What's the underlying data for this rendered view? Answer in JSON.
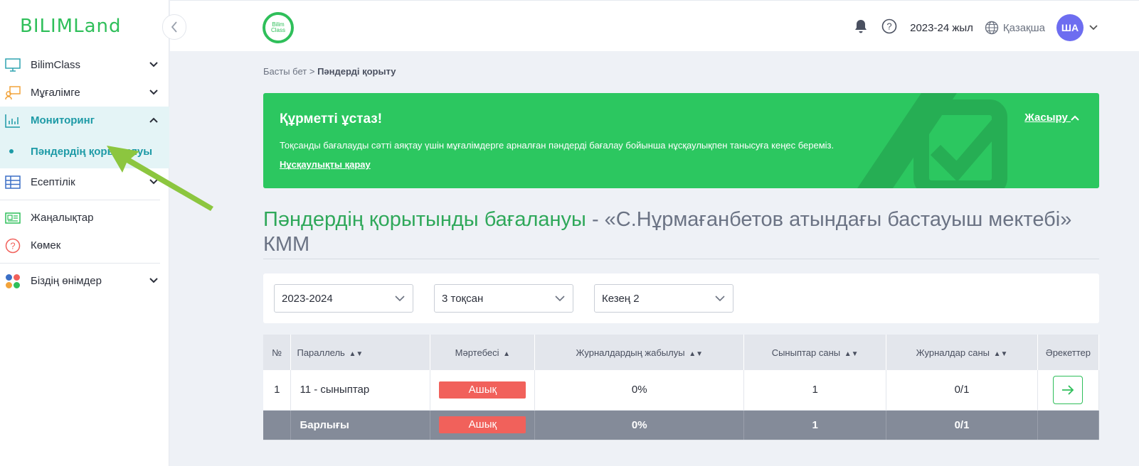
{
  "sidebar": {
    "logo": "BILIMLand",
    "items": [
      {
        "label": "BilimClass",
        "icon": "monitor-icon"
      },
      {
        "label": "Мұғалімге",
        "icon": "teacher-icon"
      },
      {
        "label": "Мониторинг",
        "icon": "chart-icon"
      },
      {
        "label": "Пәндердің қорытылуы",
        "icon": "dot"
      },
      {
        "label": "Есептілік",
        "icon": "table-icon"
      },
      {
        "label": "Жаңалықтар",
        "icon": "news-icon"
      },
      {
        "label": "Көмек",
        "icon": "help-icon"
      },
      {
        "label": "Біздің өнімдер",
        "icon": "products-icon"
      }
    ]
  },
  "topbar": {
    "logo_text": "Bilim Class",
    "year": "2023-24 жыл",
    "language": "Қазақша",
    "avatar": "ША"
  },
  "breadcrumb": {
    "home": "Басты бет",
    "current": "Пәндерді қорыту"
  },
  "banner": {
    "title": "Құрметті ұстаз!",
    "text": "Тоқсанды бағалауды сәтті аяқтау үшін мұғалімдерге арналған пәндерді бағалау бойынша нұсқаулықпен танысуға кеңес береміз.",
    "link": "Нұсқаулықты қарау",
    "hide": "Жасыру"
  },
  "page": {
    "title_green": "Пәндердің қорытынды бағалануы",
    "title_rest": " - «С.Нұрмағанбетов атындағы бастауыш мектебі» КММ"
  },
  "filters": {
    "year": "2023-2024",
    "quarter": "3 тоқсан",
    "period": "Кезең 2"
  },
  "table": {
    "headers": [
      "№",
      "Параллель",
      "Мәртебесі",
      "Журналдардың жабылуы",
      "Сыныптар саны",
      "Журналдар саны",
      "Әрекеттер"
    ],
    "row": {
      "num": "1",
      "parallel": "11 - сыныптар",
      "status": "Ашық",
      "closing": "0%",
      "classes": "1",
      "journals": "0/1"
    },
    "total": {
      "label": "Барлығы",
      "status": "Ашық",
      "closing": "0%",
      "classes": "1",
      "journals": "0/1"
    }
  }
}
